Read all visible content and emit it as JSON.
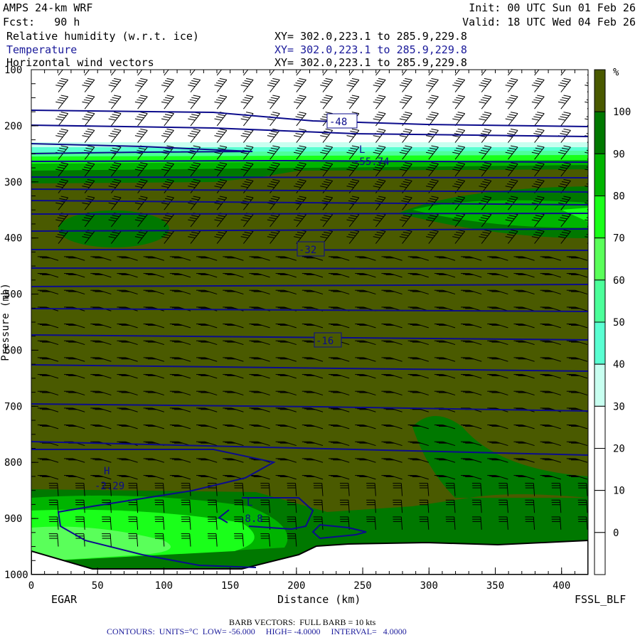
{
  "header": {
    "model": "AMPS 24-km WRF",
    "forecast": "Fcst:   90 h",
    "init": "Init: 00 UTC Sun 01 Feb 26",
    "valid": "Valid: 18 UTC Wed 04 Feb 26",
    "fields": [
      {
        "name": "Relative humidity (w.r.t. ice)",
        "xy": "XY= 302.0,223.1 to 285.9,229.8"
      },
      {
        "name": "Temperature",
        "xy": "XY= 302.0,223.1 to 285.9,229.8"
      },
      {
        "name": "Horizontal wind vectors",
        "xy": "XY= 302.0,223.1 to 285.9,229.8"
      }
    ]
  },
  "footer": {
    "left_station": "EGAR",
    "right_station": "FSSL_BLF",
    "barb_note": "BARB VECTORS:  FULL BARB = 10 kts",
    "contour_note": "CONTOURS:  UNITS=°C  LOW= -56.000     HIGH= -4.0000     INTERVAL=   4.0000"
  },
  "colors": {
    "contour": "#0c0c8c",
    "olive": "#4a5a00"
  },
  "chart_data": {
    "type": "heatmap",
    "title": "Vertical cross-section: Relative humidity (w.r.t. ice), Temperature, Horizontal wind vectors",
    "xlabel": "Distance (km)",
    "ylabel": "Pressure (mb)",
    "xlim": [
      0,
      420
    ],
    "ylim": [
      1000,
      100
    ],
    "x_ticks": [
      "0",
      "50",
      "100",
      "150",
      "200",
      "250",
      "300",
      "350",
      "400"
    ],
    "y_ticks": [
      "100",
      "200",
      "300",
      "400",
      "500",
      "600",
      "700",
      "800",
      "900",
      "1000"
    ],
    "colorbar": {
      "unit": "%",
      "labels": [
        "100",
        "90",
        "80",
        "70",
        "60",
        "50",
        "40",
        "30",
        "20",
        "10",
        "0"
      ],
      "bins": [
        {
          "range": ">100",
          "color": "#4a5a00"
        },
        {
          "range": "90-100",
          "color": "#007800"
        },
        {
          "range": "80-90",
          "color": "#00b400"
        },
        {
          "range": "70-80",
          "color": "#1aff1a"
        },
        {
          "range": "60-70",
          "color": "#5aff5a"
        },
        {
          "range": "50-60",
          "color": "#4cff9a"
        },
        {
          "range": "40-50",
          "color": "#5affd2"
        },
        {
          "range": "30-40",
          "color": "#c8fff0"
        },
        {
          "range": "20-30",
          "color": "#ffffff"
        },
        {
          "range": "10-20",
          "color": "#ffffff"
        },
        {
          "range": "0-10",
          "color": "#ffffff"
        },
        {
          "range": "<0",
          "color": "#ffffff"
        }
      ]
    },
    "contour_labels": [
      {
        "text": "-48",
        "x_km": 233,
        "p_mb": 168,
        "boxed": true
      },
      {
        "text": "-55.74",
        "x_km": 250,
        "p_mb": 240,
        "extremum": "L"
      },
      {
        "text": "-32",
        "x_km": 210,
        "p_mb": 415,
        "boxed": true
      },
      {
        "text": "-16",
        "x_km": 224,
        "p_mb": 585,
        "boxed": true
      },
      {
        "text": "-2.29",
        "x_km": 58,
        "p_mb": 840,
        "extremum": "H"
      },
      {
        "text": "-8.8",
        "x_km": 170,
        "p_mb": 900,
        "extremum": "L"
      }
    ]
  }
}
